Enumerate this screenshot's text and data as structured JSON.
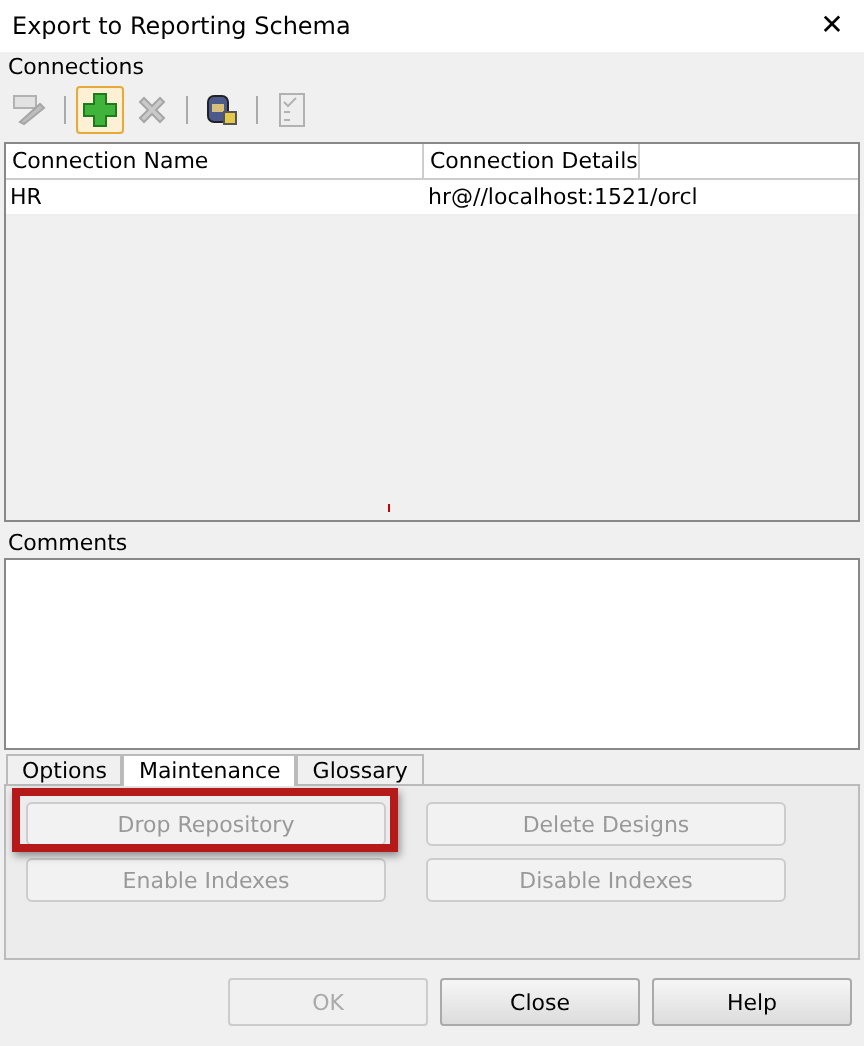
{
  "window": {
    "title": "Export to Reporting Schema",
    "close": "✕"
  },
  "connections": {
    "label": "Connections",
    "toolbar": [
      {
        "kind": "edit",
        "disabled": true,
        "highlighted": false
      },
      {
        "kind": "add",
        "disabled": false,
        "highlighted": true
      },
      {
        "kind": "delete",
        "disabled": true,
        "highlighted": false
      },
      {
        "kind": "database",
        "disabled": false,
        "highlighted": false
      },
      {
        "kind": "checklist",
        "disabled": true,
        "highlighted": false
      }
    ],
    "table": {
      "columns": [
        "Connection Name",
        "Connection Details"
      ],
      "rows": [
        [
          "HR",
          "hr@//localhost:1521/orcl"
        ]
      ]
    }
  },
  "comments": {
    "label": "Comments"
  },
  "tabs": [
    {
      "label": "Options",
      "selected": false
    },
    {
      "label": "Maintenance",
      "selected": true
    },
    {
      "label": "Glossary",
      "selected": false
    }
  ],
  "maintenance_buttons": [
    {
      "label": "Drop Repository",
      "disabled": true,
      "highlighted": true
    },
    {
      "label": "Delete Designs",
      "disabled": true,
      "highlighted": false
    },
    {
      "label": "Enable Indexes",
      "disabled": true,
      "highlighted": false
    },
    {
      "label": "Disable Indexes",
      "disabled": true,
      "highlighted": false
    }
  ],
  "buttons": [
    {
      "label": "OK",
      "disabled": true
    },
    {
      "label": "Close",
      "disabled": false
    },
    {
      "label": "Help",
      "disabled": false
    }
  ]
}
